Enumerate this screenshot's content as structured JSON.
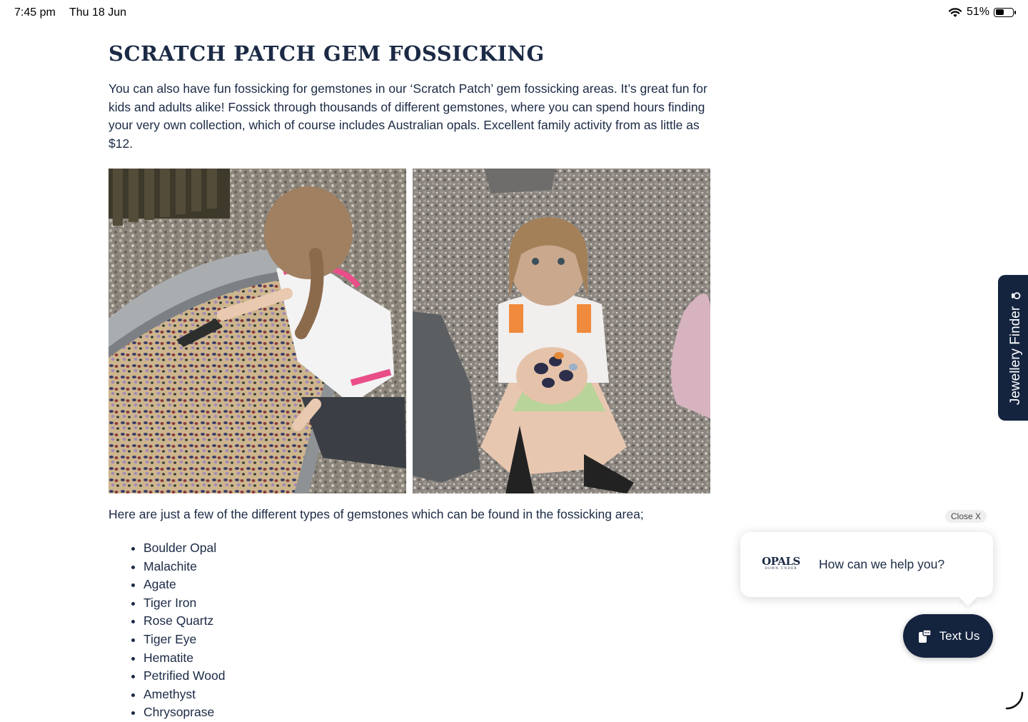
{
  "status_bar": {
    "time": "7:45 pm",
    "date": "Thu 18 Jun",
    "battery_text": "51%",
    "battery_level": 0.51
  },
  "article": {
    "title": "SCRATCH PATCH GEM FOSSICKING",
    "intro": "You can also have fun fossicking for gemstones in our ‘Scratch Patch’ gem fossicking areas. It’s great fun for kids and adults alike! Fossick through thousands of different gemstones, where you can spend hours finding your very own collection, which of course includes Australian opals. Excellent family activity from as little as $12.",
    "lead": "Here are just a few of the different types of gemstones which can be found in the fossicking area;",
    "gemstones": [
      "Boulder Opal",
      "Malachite",
      "Agate",
      "Tiger Iron",
      "Rose Quartz",
      "Tiger Eye",
      "Hematite",
      "Petrified Wood",
      "Amethyst",
      "Chrysoprase"
    ]
  },
  "jewellery_finder": {
    "label": "Jewellery Finder",
    "icon": "diamond-ring-icon"
  },
  "chat_widget": {
    "close_label": "Close X",
    "logo_main": "OPALS",
    "logo_sub": "DOWN UNDER",
    "prompt": "How can we help you?",
    "button_label": "Text Us",
    "button_icon": "chat-phone-icon"
  },
  "colors": {
    "brand_navy": "#14243f",
    "text": "#1b2a45"
  }
}
